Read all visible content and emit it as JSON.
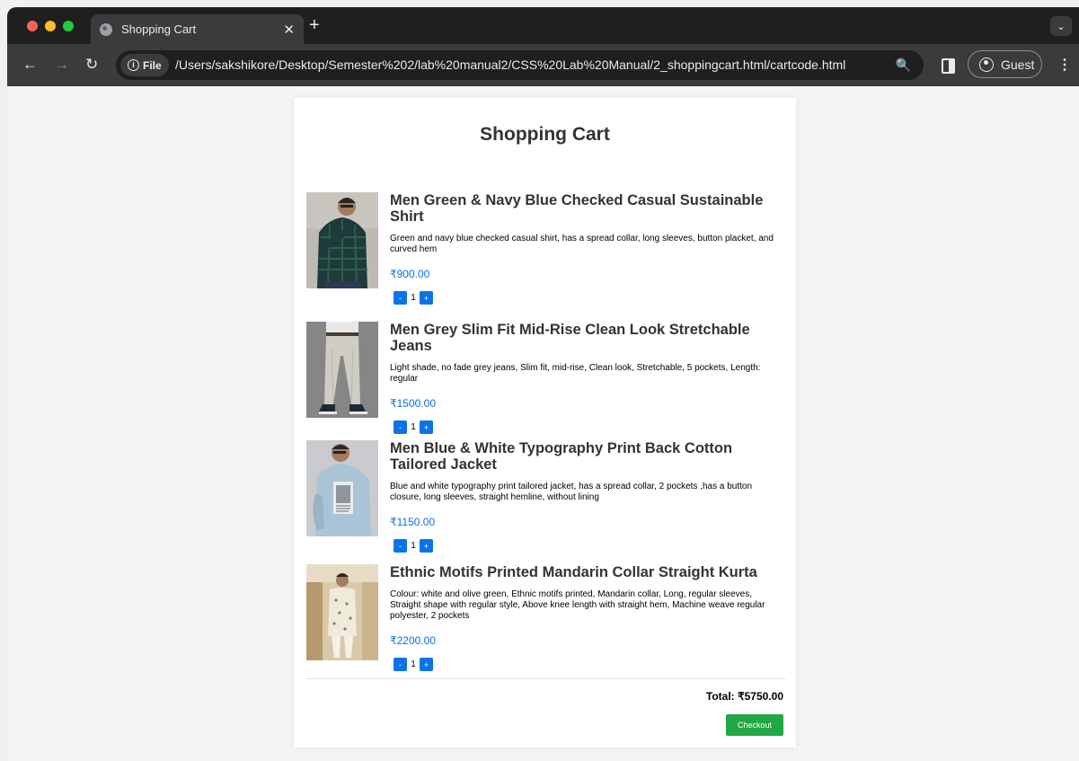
{
  "browser": {
    "tab_title": "Shopping Cart",
    "tab_close": "✕",
    "new_tab": "+",
    "tab_menu": "⌄",
    "back": "←",
    "forward": "→",
    "reload": "↻",
    "chip_label": "File",
    "url": "/Users/sakshikore/Desktop/Semester%202/lab%20manual2/CSS%20Lab%20Manual/2_shoppingcart.html/cartcode.html",
    "profile_label": "Guest",
    "menu": "⋮",
    "traffic_colors": [
      "#ff5f57",
      "#febc2e",
      "#28c840"
    ]
  },
  "cart": {
    "title": "Shopping Cart",
    "items": [
      {
        "name": "Men Green & Navy Blue Checked Casual Sustainable Shirt",
        "description": "Green and navy blue checked casual shirt, has a spread collar, long sleeves, button placket, and curved hem",
        "price": "₹900.00",
        "quantity": "1"
      },
      {
        "name": "Men Grey Slim Fit Mid-Rise Clean Look Stretchable Jeans",
        "description": "Light shade, no fade grey jeans, Slim fit, mid-rise, Clean look, Stretchable, 5 pockets, Length: regular",
        "price": "₹1500.00",
        "quantity": "1"
      },
      {
        "name": "Men Blue & White Typography Print Back Cotton Tailored Jacket",
        "description": "Blue and white typography print tailored jacket, has a spread collar, 2 pockets ,has a button closure, long sleeves, straight hemline, without lining",
        "price": "₹1150.00",
        "quantity": "1"
      },
      {
        "name": "Ethnic Motifs Printed Mandarin Collar Straight Kurta",
        "description": "Colour: white and olive green, Ethnic motifs printed, Mandarin collar, Long, regular sleeves, Straight shape with regular style, Above knee length with straight hem, Machine weave regular polyester, 2 pockets",
        "price": "₹2200.00",
        "quantity": "1"
      }
    ],
    "minus_label": "-",
    "plus_label": "+",
    "total": "Total: ₹5750.00",
    "checkout_label": "Checkout",
    "accent_blue": "#0b73e8",
    "checkout_green": "#22a745"
  }
}
